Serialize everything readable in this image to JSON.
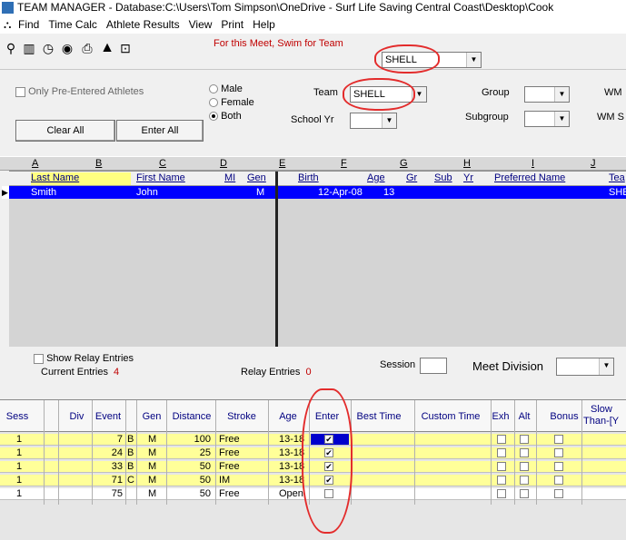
{
  "window": {
    "title": "TEAM MANAGER - Database:C:\\Users\\Tom Simpson\\OneDrive - Surf Life Saving Central Coast\\Desktop\\Cook"
  },
  "menu": [
    "Find",
    "Time Calc",
    "Athlete Results",
    "View",
    "Print",
    "Help"
  ],
  "toolbar": {
    "meet_label": "For this Meet, Swim for Team",
    "meet_team_value": "SHELL"
  },
  "filters": {
    "pre_entered_label": "Only Pre-Entered Athletes",
    "gender_options": [
      "Male",
      "Female",
      "Both"
    ],
    "gender_selected": "Both",
    "team_label": "Team",
    "team_value": "SHELL",
    "school_yr_label": "School Yr",
    "group_label": "Group",
    "subgroup_label": "Subgroup",
    "wm_label": "WM",
    "wm_s_label": "WM S",
    "clear_all": "Clear All",
    "enter_all": "Enter All"
  },
  "column_letters": [
    "A",
    "B",
    "C",
    "D",
    "E",
    "F",
    "G",
    "H",
    "I",
    "J"
  ],
  "athletes": {
    "headers": [
      "Last Name",
      "First Name",
      "MI",
      "Gen",
      "Birth",
      "Age",
      "Gr",
      "Sub",
      "Yr",
      "Preferred Name",
      "Tea"
    ],
    "rows": [
      {
        "last": "Smith",
        "first": "John",
        "mi": "",
        "gen": "M",
        "birth": "12-Apr-08",
        "age": "13",
        "gr": "",
        "sub": "",
        "yr": "",
        "preferred": "",
        "team": "SHEL"
      }
    ]
  },
  "entries_panel": {
    "show_relay_label": "Show Relay Entries",
    "current_entries_label": "Current Entries",
    "current_entries_count": "4",
    "relay_entries_label": "Relay Entries",
    "relay_entries_count": "0",
    "session_label": "Session",
    "meet_division_label": "Meet Division"
  },
  "entries": {
    "headers": [
      "Sess",
      "Div",
      "Event",
      "Gen",
      "Distance",
      "Stroke",
      "Age",
      "Enter",
      "Best Time",
      "Custom Time",
      "Exh",
      "Alt",
      "Bonus",
      "Slow",
      "Than-[Y"
    ],
    "rows": [
      {
        "sess": "1",
        "div": "",
        "event": "7",
        "ab": "B",
        "gen": "M",
        "distance": "100",
        "stroke": "Free",
        "age": "13-18",
        "enter": true
      },
      {
        "sess": "1",
        "div": "",
        "event": "24",
        "ab": "B",
        "gen": "M",
        "distance": "25",
        "stroke": "Free",
        "age": "13-18",
        "enter": true
      },
      {
        "sess": "1",
        "div": "",
        "event": "33",
        "ab": "B",
        "gen": "M",
        "distance": "50",
        "stroke": "Free",
        "age": "13-18",
        "enter": true
      },
      {
        "sess": "1",
        "div": "",
        "event": "71",
        "ab": "C",
        "gen": "M",
        "distance": "50",
        "stroke": "IM",
        "age": "13-18",
        "enter": true
      },
      {
        "sess": "1",
        "div": "",
        "event": "75",
        "ab": "",
        "gen": "M",
        "distance": "50",
        "stroke": "Free",
        "age": "Open",
        "enter": false
      }
    ]
  },
  "colors": {
    "selected_row": "#0000ff",
    "entered_row": "#ffff99",
    "annotation": "#e32c2c",
    "meet_label": "#c00000"
  }
}
